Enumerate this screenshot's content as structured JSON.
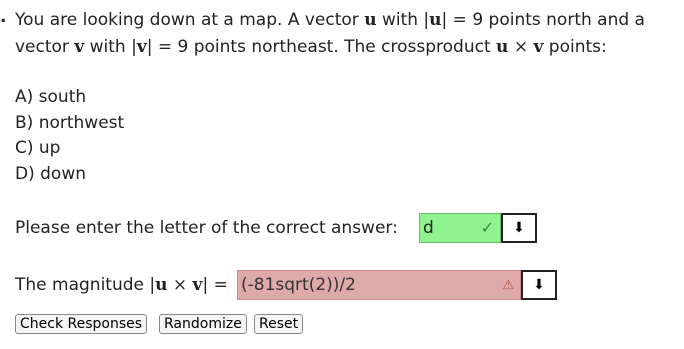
{
  "problem": {
    "bullet": ".",
    "line1_a": "You are looking down at a map. A vector ",
    "u_sym": "u",
    "line1_b": " with |",
    "line1_c": "| = 9 points north and a",
    "line2_a": "vector ",
    "v_sym": "v",
    "line2_b": " with |",
    "line2_c": "| = 9 points northeast. The crossproduct ",
    "cross_sym": " × ",
    "line2_d": " points:"
  },
  "choices": [
    "A) south",
    "B) northwest",
    "C) up",
    "D) down"
  ],
  "answer1": {
    "prompt": "Please enter the letter of the correct answer:",
    "value": "d",
    "status": "correct"
  },
  "answer2": {
    "prompt_a": "The magnitude |",
    "prompt_b": "| =",
    "value": "(-81sqrt(2))/2",
    "status": "warning"
  },
  "buttons": {
    "check": "Check Responses",
    "randomize": "Randomize",
    "reset": "Reset"
  },
  "colors": {
    "correct_bg": "#8ff38f",
    "incorrect_bg": "#dea9a9"
  }
}
